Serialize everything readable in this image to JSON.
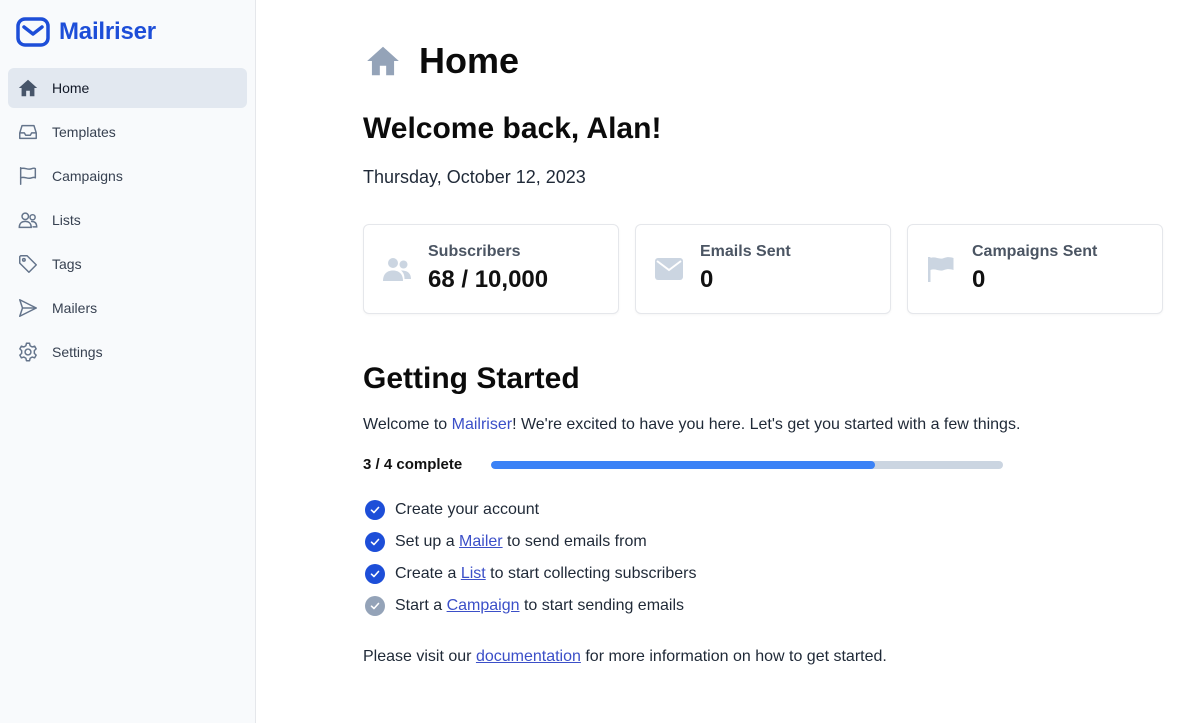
{
  "app": {
    "name": "Mailriser",
    "brand_color": "#1d4ed8"
  },
  "sidebar": {
    "items": [
      {
        "label": "Home",
        "icon": "home-icon",
        "active": true
      },
      {
        "label": "Templates",
        "icon": "inbox-icon",
        "active": false
      },
      {
        "label": "Campaigns",
        "icon": "flag-icon",
        "active": false
      },
      {
        "label": "Lists",
        "icon": "users-icon",
        "active": false
      },
      {
        "label": "Tags",
        "icon": "tag-icon",
        "active": false
      },
      {
        "label": "Mailers",
        "icon": "paper-plane-icon",
        "active": false
      },
      {
        "label": "Settings",
        "icon": "gear-icon",
        "active": false
      }
    ]
  },
  "header": {
    "title": "Home",
    "icon": "home-icon"
  },
  "welcome": {
    "heading": "Welcome back, Alan!",
    "date": "Thursday, October 12, 2023"
  },
  "stats": [
    {
      "label": "Subscribers",
      "value": "68 / 10,000",
      "icon": "users-icon"
    },
    {
      "label": "Emails Sent",
      "value": "0",
      "icon": "envelope-icon"
    },
    {
      "label": "Campaigns Sent",
      "value": "0",
      "icon": "flag-icon"
    }
  ],
  "getting_started": {
    "title": "Getting Started",
    "intro_before": "Welcome to ",
    "intro_brand": "Mailriser",
    "intro_after": "! We're excited to have you here. Let's get you started with a few things.",
    "progress_label": "3 / 4 complete",
    "progress_fraction": 0.75,
    "tasks": [
      {
        "before": "Create your account",
        "link": "",
        "after": "",
        "done": true
      },
      {
        "before": "Set up a ",
        "link": "Mailer",
        "after": " to send emails from",
        "done": true
      },
      {
        "before": "Create a ",
        "link": "List",
        "after": " to start collecting subscribers",
        "done": true
      },
      {
        "before": "Start a ",
        "link": "Campaign",
        "after": " to start sending emails",
        "done": false
      }
    ],
    "footer_before": "Please visit our ",
    "footer_link": "documentation",
    "footer_after": " for more information on how to get started."
  },
  "colors": {
    "accent": "#3b4fc8",
    "progress": "#3b82f6",
    "check_done": "#1d4ed8",
    "check_todo": "#94a3b8"
  }
}
